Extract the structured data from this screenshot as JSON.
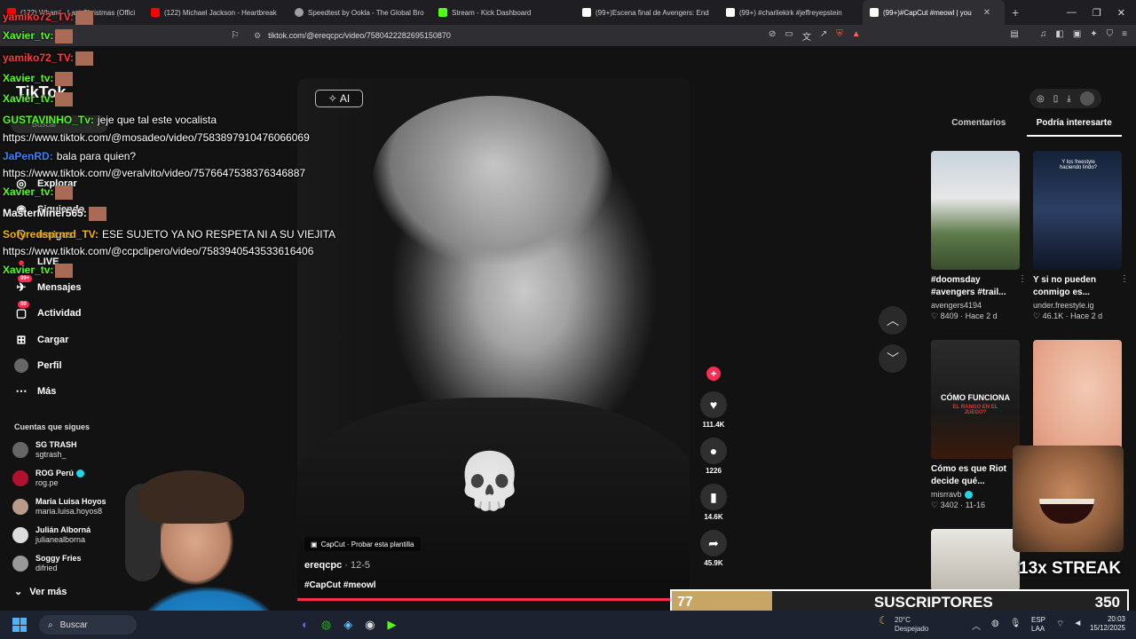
{
  "browser": {
    "tabs": [
      {
        "label": "(122) Whaml - Last Christmas (Offici",
        "color": "#ff0000"
      },
      {
        "label": "(122) Michael Jackson - Heartbreak",
        "color": "#ff0000"
      },
      {
        "label": "Speedtest by Ookla - The Global Bro",
        "color": "#9aa0a6"
      },
      {
        "label": "Stream - Kick Dashboard",
        "color": "#53fc18"
      },
      {
        "label": "(99+)Escena final de Avengers: End",
        "color": "#ffffff"
      },
      {
        "label": "(99+) #charliekirk #jeffreyepstein",
        "color": "#ffffff"
      },
      {
        "label": "(99+)#CapCut #meowl | you",
        "color": "#ffffff"
      }
    ],
    "url": "tiktok.com/@ereqcpc/video/7580422282695150870"
  },
  "tiktok": {
    "logo": "TikTok",
    "search_placeholder": "Buscar",
    "nav": [
      {
        "label": "Explorar",
        "icon": "compass-icon"
      },
      {
        "label": "Siguiendo",
        "icon": "following-icon"
      },
      {
        "label": "Amigos",
        "icon": "friends-icon"
      },
      {
        "label": "LIVE",
        "icon": "live-icon"
      },
      {
        "label": "Mensajes",
        "icon": "messages-icon",
        "badge": "99+"
      },
      {
        "label": "Actividad",
        "icon": "activity-icon",
        "badge": "80"
      },
      {
        "label": "Cargar",
        "icon": "upload-icon"
      },
      {
        "label": "Perfil",
        "icon": "profile-icon"
      },
      {
        "label": "Más",
        "icon": "more-icon"
      }
    ],
    "following_title": "Cuentas que sigues",
    "following": [
      {
        "name": "SG TRASH",
        "handle": "sgtrash_",
        "verified": false
      },
      {
        "name": "ROG Perú",
        "handle": "rog.pe",
        "verified": true
      },
      {
        "name": "Maria Luisa Hoyos",
        "handle": "maria.luisa.hoyos8",
        "verified": false
      },
      {
        "name": "Julián Alborná",
        "handle": "julianealborna",
        "verified": false
      },
      {
        "name": "Soggy Fries",
        "handle": "difried",
        "verified": false
      }
    ],
    "see_more": "Ver más",
    "video": {
      "ai_label": "AI",
      "capcut_label": "CapCut · Probar esta plantilla",
      "author": "ereqcpc",
      "date": "12-5",
      "caption": "#CapCut #meowl",
      "progress": 0.95
    },
    "actions": {
      "likes": "111.4K",
      "comments": "1226",
      "saves": "14.6K",
      "shares": "45.9K"
    },
    "right_panel": {
      "tabs": [
        "Comentarios",
        "Podría interesarte"
      ],
      "active_tab": 1,
      "cards": [
        {
          "title": "#doomsday #avengers #trail...",
          "author": "avengers4194",
          "likes": "8409",
          "date": "Hace 2 d",
          "verified": false
        },
        {
          "title": "Y si no pueden conmigo es...",
          "author": "under.freestyle.ig",
          "likes": "46.1K",
          "date": "Hace 2 d",
          "verified": false
        },
        {
          "title": "Cómo es que Riot decide qué...",
          "author": "misrravb",
          "likes": "3402",
          "date": "11-16",
          "verified": true
        },
        {
          "title": "",
          "author": "",
          "likes": "",
          "date": "",
          "verified": false
        }
      ],
      "thumb_texts": {
        "card2": "Y los freestyle haciendo lindo?",
        "card3_line1": "CÓMO FUNCIONA",
        "card3_line2": "EL RANGO EN EL JUEGO?"
      }
    }
  },
  "stream": {
    "chat": [
      {
        "user": "yamiko72_TV:",
        "text": "",
        "color": "#ff3b3b"
      },
      {
        "user": "Xavier_tv:",
        "text": "",
        "color": "#53fc18"
      },
      {
        "user": "yamiko72_TV:",
        "text": "",
        "color": "#ff3b3b"
      },
      {
        "user": "Xavier_tv:",
        "text": "",
        "color": "#53fc18"
      },
      {
        "user": "Xavier_tv:",
        "text": "",
        "color": "#53fc18"
      },
      {
        "user": "GUSTAVINHO_Tv:",
        "text": "jeje que tal este vocalista",
        "color": "#53fc18"
      },
      {
        "user": "",
        "text": "https://www.tiktok.com/@mosadeo/video/7583897910476066069",
        "color": "#ffffff"
      },
      {
        "user": "JaPenRD:",
        "text": "bala para quien?",
        "color": "#3b82f6"
      },
      {
        "user": "",
        "text": "https://www.tiktok.com/@veralvito/video/7576647538376346887",
        "color": "#ffffff"
      },
      {
        "user": "Xavier_tv:",
        "text": "",
        "color": "#53fc18"
      },
      {
        "user": "MasterMiner565:",
        "text": "",
        "color": "#ffffff"
      },
      {
        "user": "Sofyredsprnrd_TV:",
        "text": "ESE SUJETO YA NO RESPETA NI A SU VIEJITA",
        "color": "#f5b400"
      },
      {
        "user": "",
        "text": "https://www.tiktok.com/@ccpclipero/video/7583940543533616406",
        "color": "#ffffff"
      },
      {
        "user": "Xavier_tv:",
        "text": "",
        "color": "#53fc18"
      }
    ],
    "streak": "13x STREAK",
    "sub_goal": {
      "current": "77",
      "label": "SUSCRIPTORES",
      "goal": "350",
      "progress": 0.22
    }
  },
  "taskbar": {
    "search": "Buscar",
    "weather_temp": "20°C",
    "weather_desc": "Despejado",
    "lang1": "ESP",
    "lang2": "LAA",
    "time": "20:03",
    "date": "15/12/2025"
  }
}
